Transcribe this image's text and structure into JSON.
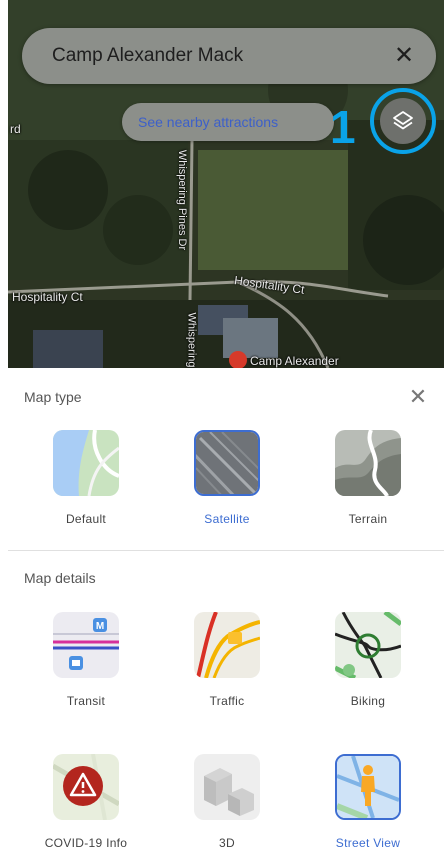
{
  "search": {
    "query": "Camp Alexander Mack"
  },
  "nearby_chip": {
    "label": "See nearby attractions"
  },
  "annotation": {
    "number": "1"
  },
  "map_labels": {
    "road_left": "Hospitality Ct",
    "road_right": "Hospitality Ct",
    "road_vertical": "Whispering Pines Dr",
    "road_bottom": "Whispering",
    "place": "Camp Alexander",
    "edge_fragment": "rd"
  },
  "map_type": {
    "title": "Map type",
    "options": [
      {
        "label": "Default",
        "selected": false
      },
      {
        "label": "Satellite",
        "selected": true
      },
      {
        "label": "Terrain",
        "selected": false
      }
    ]
  },
  "map_details": {
    "title": "Map details",
    "options": [
      {
        "label": "Transit",
        "selected": false
      },
      {
        "label": "Traffic",
        "selected": false
      },
      {
        "label": "Biking",
        "selected": false
      },
      {
        "label": "COVID-19 Info",
        "selected": false
      },
      {
        "label": "3D",
        "selected": false
      },
      {
        "label": "Street View",
        "selected": true
      }
    ]
  },
  "colors": {
    "accent": "#3d6dd1",
    "annotation": "#0aa3e8",
    "chip_text": "#3d60c9"
  }
}
